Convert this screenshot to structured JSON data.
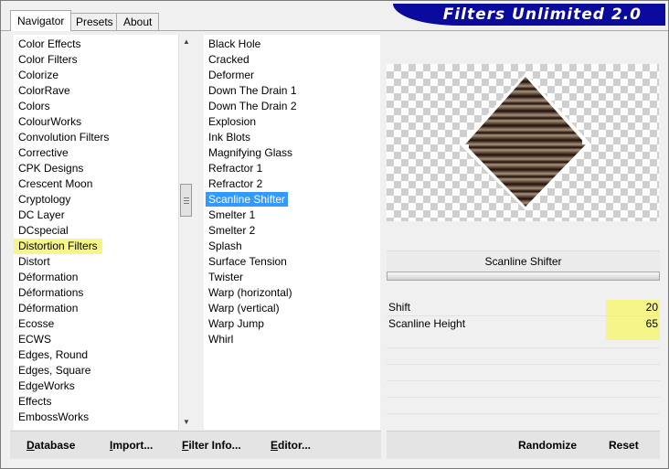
{
  "tabs": [
    "Navigator",
    "Presets",
    "About"
  ],
  "banner": "Filters Unlimited 2.0",
  "categories": [
    "Color Effects",
    "Color Filters",
    "Colorize",
    "ColorRave",
    "Colors",
    "ColourWorks",
    "Convolution Filters",
    "Corrective",
    "CPK Designs",
    "Crescent Moon",
    "Cryptology",
    "DC Layer",
    "DCspecial",
    "Distortion Filters",
    "Distort",
    "Déformation",
    "Déformations",
    "Déformation",
    "Ecosse",
    "ECWS",
    "Edges, Round",
    "Edges, Square",
    "EdgeWorks",
    "Effects",
    "EmbossWorks"
  ],
  "selected_category": "Distortion Filters",
  "filters": [
    "Black Hole",
    "Cracked",
    "Deformer",
    "Down The Drain 1",
    "Down The Drain 2",
    "Explosion",
    "Ink Blots",
    "Magnifying Glass",
    "Refractor 1",
    "Refractor 2",
    "Scanline Shifter",
    "Smelter 1",
    "Smelter 2",
    "Splash",
    "Surface Tension",
    "Twister",
    "Warp (horizontal)",
    "Warp (vertical)",
    "Warp Jump",
    "Whirl"
  ],
  "selected_filter": "Scanline Shifter",
  "filter_name": "Scanline Shifter",
  "params": [
    {
      "label": "Shift",
      "value": "20"
    },
    {
      "label": "Scanline Height",
      "value": "65"
    }
  ],
  "buttons": {
    "database": {
      "u": "D",
      "rest": "atabase"
    },
    "import": {
      "u": "I",
      "rest": "mport..."
    },
    "filter_info": {
      "u": "F",
      "rest": "ilter Info..."
    },
    "editor": {
      "u": "E",
      "rest": "ditor..."
    },
    "randomize": "Randomize",
    "reset": "Reset"
  },
  "icons": {
    "scroll_up": "arrow-up-icon",
    "scroll_down": "arrow-down-icon"
  },
  "colors": {
    "selection_blue": "#3399ff",
    "highlight_yellow": "#f5f58a",
    "banner_blue": "#0a0a9c"
  }
}
